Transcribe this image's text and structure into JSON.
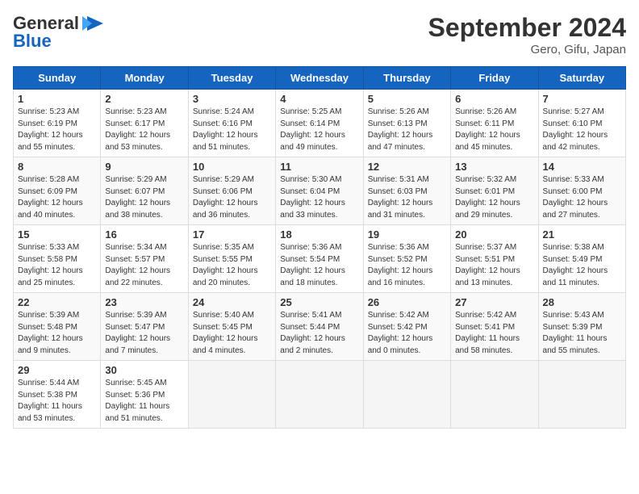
{
  "logo": {
    "line1": "General",
    "line2": "Blue",
    "icon": "▶"
  },
  "title": "September 2024",
  "location": "Gero, Gifu, Japan",
  "days_of_week": [
    "Sunday",
    "Monday",
    "Tuesday",
    "Wednesday",
    "Thursday",
    "Friday",
    "Saturday"
  ],
  "weeks": [
    [
      {
        "day": "1",
        "sunrise": "5:23 AM",
        "sunset": "6:19 PM",
        "daylight": "12 hours and 55 minutes."
      },
      {
        "day": "2",
        "sunrise": "5:23 AM",
        "sunset": "6:17 PM",
        "daylight": "12 hours and 53 minutes."
      },
      {
        "day": "3",
        "sunrise": "5:24 AM",
        "sunset": "6:16 PM",
        "daylight": "12 hours and 51 minutes."
      },
      {
        "day": "4",
        "sunrise": "5:25 AM",
        "sunset": "6:14 PM",
        "daylight": "12 hours and 49 minutes."
      },
      {
        "day": "5",
        "sunrise": "5:26 AM",
        "sunset": "6:13 PM",
        "daylight": "12 hours and 47 minutes."
      },
      {
        "day": "6",
        "sunrise": "5:26 AM",
        "sunset": "6:11 PM",
        "daylight": "12 hours and 45 minutes."
      },
      {
        "day": "7",
        "sunrise": "5:27 AM",
        "sunset": "6:10 PM",
        "daylight": "12 hours and 42 minutes."
      }
    ],
    [
      {
        "day": "8",
        "sunrise": "5:28 AM",
        "sunset": "6:09 PM",
        "daylight": "12 hours and 40 minutes."
      },
      {
        "day": "9",
        "sunrise": "5:29 AM",
        "sunset": "6:07 PM",
        "daylight": "12 hours and 38 minutes."
      },
      {
        "day": "10",
        "sunrise": "5:29 AM",
        "sunset": "6:06 PM",
        "daylight": "12 hours and 36 minutes."
      },
      {
        "day": "11",
        "sunrise": "5:30 AM",
        "sunset": "6:04 PM",
        "daylight": "12 hours and 33 minutes."
      },
      {
        "day": "12",
        "sunrise": "5:31 AM",
        "sunset": "6:03 PM",
        "daylight": "12 hours and 31 minutes."
      },
      {
        "day": "13",
        "sunrise": "5:32 AM",
        "sunset": "6:01 PM",
        "daylight": "12 hours and 29 minutes."
      },
      {
        "day": "14",
        "sunrise": "5:33 AM",
        "sunset": "6:00 PM",
        "daylight": "12 hours and 27 minutes."
      }
    ],
    [
      {
        "day": "15",
        "sunrise": "5:33 AM",
        "sunset": "5:58 PM",
        "daylight": "12 hours and 25 minutes."
      },
      {
        "day": "16",
        "sunrise": "5:34 AM",
        "sunset": "5:57 PM",
        "daylight": "12 hours and 22 minutes."
      },
      {
        "day": "17",
        "sunrise": "5:35 AM",
        "sunset": "5:55 PM",
        "daylight": "12 hours and 20 minutes."
      },
      {
        "day": "18",
        "sunrise": "5:36 AM",
        "sunset": "5:54 PM",
        "daylight": "12 hours and 18 minutes."
      },
      {
        "day": "19",
        "sunrise": "5:36 AM",
        "sunset": "5:52 PM",
        "daylight": "12 hours and 16 minutes."
      },
      {
        "day": "20",
        "sunrise": "5:37 AM",
        "sunset": "5:51 PM",
        "daylight": "12 hours and 13 minutes."
      },
      {
        "day": "21",
        "sunrise": "5:38 AM",
        "sunset": "5:49 PM",
        "daylight": "12 hours and 11 minutes."
      }
    ],
    [
      {
        "day": "22",
        "sunrise": "5:39 AM",
        "sunset": "5:48 PM",
        "daylight": "12 hours and 9 minutes."
      },
      {
        "day": "23",
        "sunrise": "5:39 AM",
        "sunset": "5:47 PM",
        "daylight": "12 hours and 7 minutes."
      },
      {
        "day": "24",
        "sunrise": "5:40 AM",
        "sunset": "5:45 PM",
        "daylight": "12 hours and 4 minutes."
      },
      {
        "day": "25",
        "sunrise": "5:41 AM",
        "sunset": "5:44 PM",
        "daylight": "12 hours and 2 minutes."
      },
      {
        "day": "26",
        "sunrise": "5:42 AM",
        "sunset": "5:42 PM",
        "daylight": "12 hours and 0 minutes."
      },
      {
        "day": "27",
        "sunrise": "5:42 AM",
        "sunset": "5:41 PM",
        "daylight": "11 hours and 58 minutes."
      },
      {
        "day": "28",
        "sunrise": "5:43 AM",
        "sunset": "5:39 PM",
        "daylight": "11 hours and 55 minutes."
      }
    ],
    [
      {
        "day": "29",
        "sunrise": "5:44 AM",
        "sunset": "5:38 PM",
        "daylight": "11 hours and 53 minutes."
      },
      {
        "day": "30",
        "sunrise": "5:45 AM",
        "sunset": "5:36 PM",
        "daylight": "11 hours and 51 minutes."
      },
      null,
      null,
      null,
      null,
      null
    ]
  ]
}
